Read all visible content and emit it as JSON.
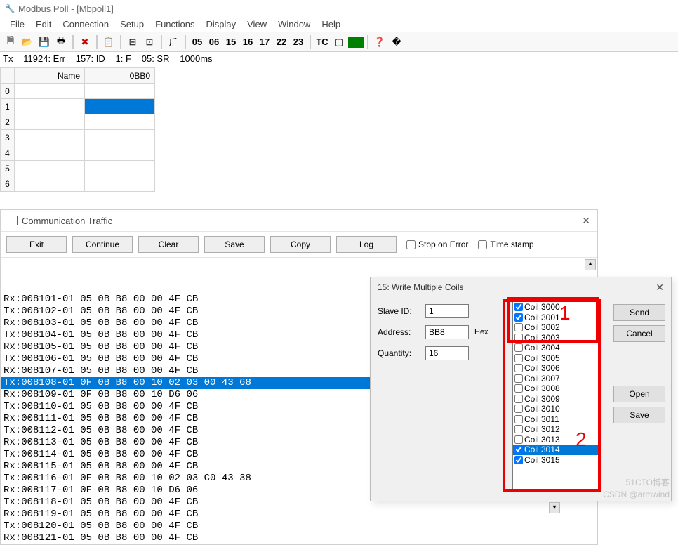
{
  "window": {
    "title": "Modbus Poll - [Mbpoll1]"
  },
  "menu": {
    "items": [
      "File",
      "Edit",
      "Connection",
      "Setup",
      "Functions",
      "Display",
      "View",
      "Window",
      "Help"
    ]
  },
  "toolbar": {
    "codes": [
      "05",
      "06",
      "15",
      "16",
      "17",
      "22",
      "23"
    ],
    "tc": "TC"
  },
  "status": {
    "text": "Tx = 11924: Err = 157: ID = 1: F = 05: SR = 1000ms"
  },
  "grid": {
    "columns": [
      "Name",
      "0BB0"
    ],
    "rows": [
      "0",
      "1",
      "2",
      "3",
      "4",
      "5",
      "6"
    ]
  },
  "comm": {
    "title": "Communication Traffic",
    "buttons": {
      "exit": "Exit",
      "continue": "Continue",
      "clear": "Clear",
      "save": "Save",
      "copy": "Copy",
      "log": "Log"
    },
    "stop_on_error": "Stop on Error",
    "time_stamp": "Time stamp",
    "lines": [
      "Rx:008101-01 05 0B B8 00 00 4F CB",
      "Tx:008102-01 05 0B B8 00 00 4F CB",
      "Rx:008103-01 05 0B B8 00 00 4F CB",
      "Tx:008104-01 05 0B B8 00 00 4F CB",
      "Rx:008105-01 05 0B B8 00 00 4F CB",
      "Tx:008106-01 05 0B B8 00 00 4F CB",
      "Rx:008107-01 05 0B B8 00 00 4F CB",
      "Tx:008108-01 0F 0B B8 00 10 02 03 00 43 68",
      "Rx:008109-01 0F 0B B8 00 10 D6 06",
      "Tx:008110-01 05 0B B8 00 00 4F CB",
      "Rx:008111-01 05 0B B8 00 00 4F CB",
      "Tx:008112-01 05 0B B8 00 00 4F CB",
      "Rx:008113-01 05 0B B8 00 00 4F CB",
      "Tx:008114-01 05 0B B8 00 00 4F CB",
      "Rx:008115-01 05 0B B8 00 00 4F CB",
      "Tx:008116-01 0F 0B B8 00 10 02 03 C0 43 38",
      "Rx:008117-01 0F 0B B8 00 10 D6 06",
      "Tx:008118-01 05 0B B8 00 00 4F CB",
      "Rx:008119-01 05 0B B8 00 00 4F CB",
      "Tx:008120-01 05 0B B8 00 00 4F CB",
      "Rx:008121-01 05 0B B8 00 00 4F CB"
    ],
    "highlight_index": 7
  },
  "dialog": {
    "title": "15: Write Multiple Coils",
    "labels": {
      "slave_id": "Slave ID:",
      "address": "Address:",
      "quantity": "Quantity:",
      "hex": "Hex"
    },
    "values": {
      "slave_id": "1",
      "address": "BB8",
      "quantity": "16"
    },
    "buttons": {
      "send": "Send",
      "cancel": "Cancel",
      "open": "Open",
      "save": "Save"
    },
    "coils": [
      {
        "label": "Coil 3000",
        "checked": true,
        "sel": false
      },
      {
        "label": "Coil 3001",
        "checked": true,
        "sel": false
      },
      {
        "label": "Coil 3002",
        "checked": false,
        "sel": false
      },
      {
        "label": "Coil 3003",
        "checked": false,
        "sel": false
      },
      {
        "label": "Coil 3004",
        "checked": false,
        "sel": false
      },
      {
        "label": "Coil 3005",
        "checked": false,
        "sel": false
      },
      {
        "label": "Coil 3006",
        "checked": false,
        "sel": false
      },
      {
        "label": "Coil 3007",
        "checked": false,
        "sel": false
      },
      {
        "label": "Coil 3008",
        "checked": false,
        "sel": false
      },
      {
        "label": "Coil 3009",
        "checked": false,
        "sel": false
      },
      {
        "label": "Coil 3010",
        "checked": false,
        "sel": false
      },
      {
        "label": "Coil 3011",
        "checked": false,
        "sel": false
      },
      {
        "label": "Coil 3012",
        "checked": false,
        "sel": false
      },
      {
        "label": "Coil 3013",
        "checked": false,
        "sel": false
      },
      {
        "label": "Coil 3014",
        "checked": true,
        "sel": true
      },
      {
        "label": "Coil 3015",
        "checked": true,
        "sel": false
      }
    ]
  },
  "annotations": {
    "one": "1",
    "two": "2"
  },
  "watermark": {
    "line1": "51CTO博客",
    "line2": "CSDN @armwind"
  }
}
